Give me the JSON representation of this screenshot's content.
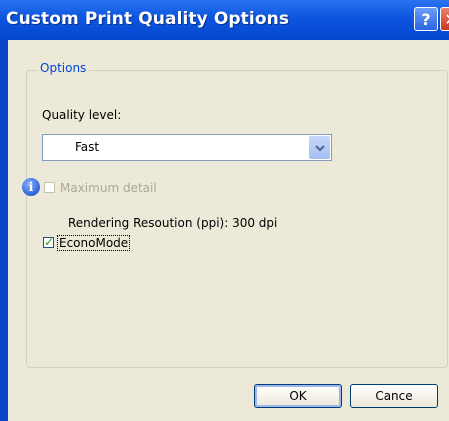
{
  "window": {
    "title": "Custom Print Quality Options",
    "help_label": "?",
    "close_label": "✕"
  },
  "options": {
    "group_label": "Options",
    "quality_label": "Quality level:",
    "quality_value": "Fast",
    "max_detail_label": "Maximum detail",
    "max_detail_checked": false,
    "max_detail_enabled": false,
    "rendering_label": "Rendering Resoution (ppi): 300 dpi",
    "economode_label": "EconoMode",
    "economode_checked": true
  },
  "buttons": {
    "ok": "OK",
    "cancel": "Cance"
  },
  "icons": {
    "info": "info-icon",
    "dropdown": "chevron-down-icon"
  },
  "colors": {
    "titlebar": "#0c55df",
    "dialog_bg": "#ece9d8",
    "group_label": "#0046d5"
  }
}
